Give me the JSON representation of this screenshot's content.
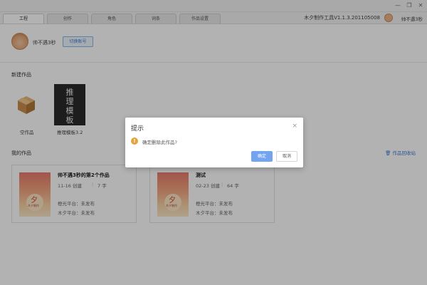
{
  "window": {
    "minimize_glyph": "—",
    "restore_glyph": "❐",
    "close_glyph": "✕"
  },
  "tabs": [
    {
      "label": "工程",
      "active": true
    },
    {
      "label": "创作",
      "active": false
    },
    {
      "label": "角色",
      "active": false
    },
    {
      "label": "词条",
      "active": false
    },
    {
      "label": "作品设置",
      "active": false
    }
  ],
  "header": {
    "version": "木夕制作工具V1.1.3.201105008",
    "username": "帅不遇3秒"
  },
  "user": {
    "name": "帅不遇3秒",
    "switch_account_label": "切换账号"
  },
  "new_works": {
    "title": "新建作品",
    "items": [
      {
        "label": "空作品"
      },
      {
        "label": "推理模板3.2",
        "thumbnail_text": [
          "推",
          "理",
          "模",
          "板"
        ]
      }
    ]
  },
  "my_works": {
    "title": "我的作品",
    "recycle_label": "作品回收站",
    "cards": [
      {
        "title": "帅不遇3秒的第2个作品",
        "created": "11-16 创建",
        "words": "7 字",
        "platform1": "橙光平台：未发布",
        "platform2": "木夕平台：未发布"
      },
      {
        "title": "测试",
        "created": "02-23 创建",
        "words": "64 字",
        "platform1": "橙光平台：未发布",
        "platform2": "木夕平台：未发布"
      }
    ]
  },
  "dialog": {
    "title": "提示",
    "close_glyph": "×",
    "warn_glyph": "!",
    "message": "确定删除此作品?",
    "confirm_label": "确定",
    "cancel_label": "取消"
  },
  "colors": {
    "accent": "#3d7bd1",
    "confirm_button": "#73a4f0",
    "warning": "#e6a23c"
  }
}
